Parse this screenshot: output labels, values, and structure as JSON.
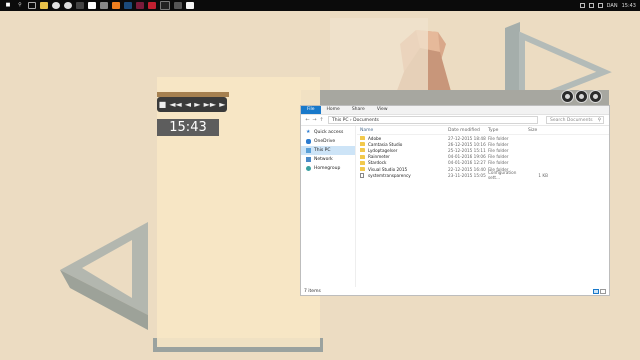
{
  "taskbar": {
    "icons": [
      "start-icon",
      "search-icon",
      "task-view-icon",
      "folder-icon",
      "chrome-icon",
      "xbox-icon",
      "store-icon",
      "media-player-icon",
      "steam-icon",
      "vlc-icon",
      "photoshop-icon",
      "illustrator-icon",
      "app-icon",
      "terminal-icon",
      "app-icon-2",
      "file-icon"
    ],
    "lang": "DAN",
    "time": "15:43"
  },
  "media": {
    "clock": "15:43",
    "controls": [
      "■",
      "◄◄",
      "◄",
      "►",
      "►►",
      "►"
    ]
  },
  "explorer": {
    "tabs": [
      "File",
      "Home",
      "Share",
      "View"
    ],
    "address": "This PC  ›  Documents",
    "search_placeholder": "Search Documents",
    "nav": [
      "Quick access",
      "OneDrive",
      "This PC",
      "Network",
      "Homegroup"
    ],
    "columns": {
      "name": "Name",
      "date": "Date modified",
      "type": "Type",
      "size": "Size"
    },
    "files": [
      {
        "name": "Adobe",
        "date": "27-12-2015 18:48",
        "type": "File folder",
        "size": "",
        "kind": "folder"
      },
      {
        "name": "Camtasia Studio",
        "date": "26-12-2015 10:16",
        "type": "File folder",
        "size": "",
        "kind": "folder"
      },
      {
        "name": "Lydoptagelser",
        "date": "25-12-2015 15:11",
        "type": "File folder",
        "size": "",
        "kind": "folder"
      },
      {
        "name": "Rainmeter",
        "date": "04-01-2016 19:06",
        "type": "File folder",
        "size": "",
        "kind": "folder"
      },
      {
        "name": "Stardock",
        "date": "04-01-2016 12:27",
        "type": "File folder",
        "size": "",
        "kind": "folder"
      },
      {
        "name": "Visual Studio 2015",
        "date": "22-12-2015 16:40",
        "type": "File folder",
        "size": "",
        "kind": "folder"
      },
      {
        "name": "systemtransparency",
        "date": "23-11-2015 15:05",
        "type": "Configuration sett...",
        "size": "1 KB",
        "kind": "file"
      }
    ],
    "status": "7 items"
  }
}
